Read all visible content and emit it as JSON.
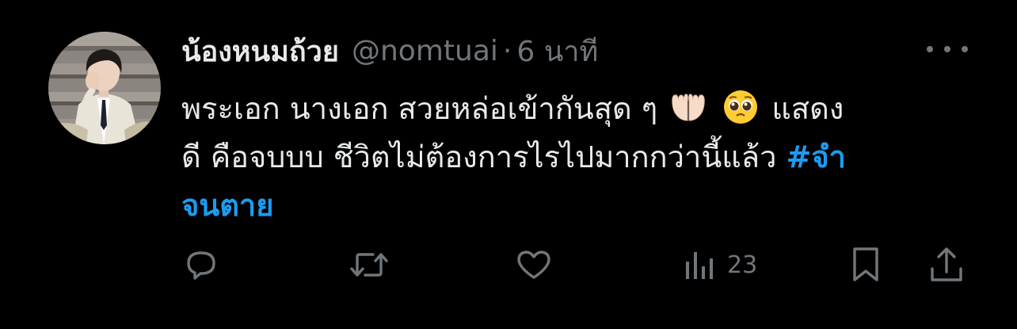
{
  "tweet": {
    "display_name": "น้องหนมถ้วย",
    "handle": "@nomtuai",
    "separator": "·",
    "time": "6 นาที",
    "text_line1_before": "พระเอก นางเอก สวยหล่อเข้ากันสุด ๆ",
    "text_line1_after": "แสดง",
    "text_line2_before": "ดี คือจบบบ ชีวิตไม่ต้องการไรไปมากกว่านี้แล้ว",
    "hashtag_part1": "#จำ",
    "hashtag_part2": "จนตาย",
    "emoji_1": "palms-up-together",
    "emoji_2": "pleading-face"
  },
  "actions": {
    "reply_icon": "reply-icon",
    "retweet_icon": "retweet-icon",
    "like_icon": "heart-icon",
    "views_icon": "views-icon",
    "views_count": "23",
    "bookmark_icon": "bookmark-icon",
    "share_icon": "share-icon"
  },
  "colors": {
    "background": "#000000",
    "text": "#e7e9ea",
    "muted": "#71767b",
    "link": "#1d9bf0"
  }
}
